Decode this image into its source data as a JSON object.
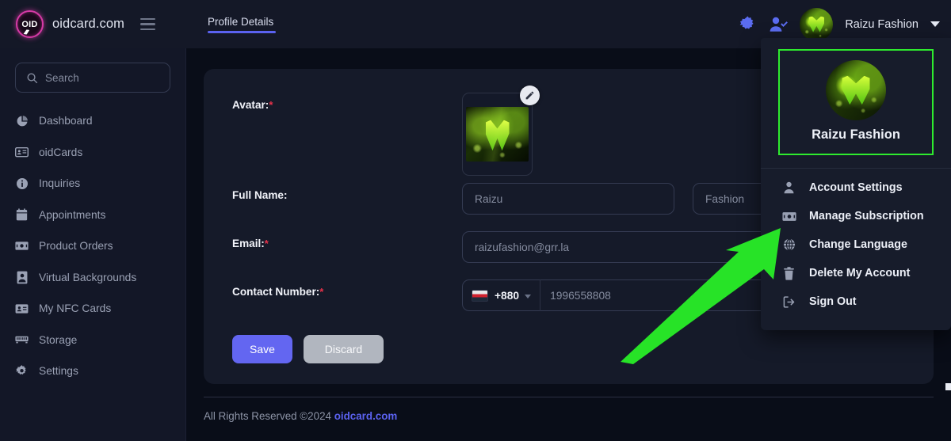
{
  "brand": {
    "name": "oidcard.com",
    "logo_text": "OID",
    "menu_icon": "hamburger-icon"
  },
  "header": {
    "tab": {
      "label": "Profile Details"
    },
    "settings_icon": "gear-icon",
    "user_check_icon": "user-check-icon",
    "user_name": "Raizu Fashion",
    "chevron_icon": "chevron-down-icon"
  },
  "sidebar": {
    "search": {
      "placeholder": "Search",
      "icon": "search-icon"
    },
    "items": [
      {
        "label": "Dashboard",
        "icon": "pie-chart-icon"
      },
      {
        "label": "oidCards",
        "icon": "id-card-icon"
      },
      {
        "label": "Inquiries",
        "icon": "info-icon"
      },
      {
        "label": "Appointments",
        "icon": "calendar-icon"
      },
      {
        "label": "Product Orders",
        "icon": "money-icon"
      },
      {
        "label": "Virtual Backgrounds",
        "icon": "portrait-icon"
      },
      {
        "label": "My NFC Cards",
        "icon": "contact-card-icon"
      },
      {
        "label": "Storage",
        "icon": "storage-icon"
      },
      {
        "label": "Settings",
        "icon": "gear-icon"
      }
    ]
  },
  "form": {
    "avatar": {
      "label": "Avatar:",
      "required": "*",
      "edit_icon": "pencil-icon"
    },
    "full_name": {
      "label": "Full Name:",
      "first_placeholder": "Raizu",
      "last_placeholder": "Fashion"
    },
    "email": {
      "label": "Email:",
      "required": "*",
      "placeholder": "raizufashion@grr.la"
    },
    "contact": {
      "label": "Contact Number:",
      "required": "*",
      "country_code": "+880",
      "flag_icon": "bangladesh-flag-icon",
      "placeholder": "1996558808"
    },
    "save_label": "Save",
    "discard_label": "Discard"
  },
  "footer": {
    "text": "All Rights Reserved ©2024",
    "link": "oidcard.com"
  },
  "dropdown": {
    "profile_name": "Raizu Fashion",
    "highlight_color": "#2eeb2e",
    "items": [
      {
        "label": "Account Settings",
        "icon": "person-icon"
      },
      {
        "label": "Manage Subscription",
        "icon": "money-icon"
      },
      {
        "label": "Change Language",
        "icon": "globe-icon"
      },
      {
        "label": "Delete My Account",
        "icon": "trash-icon"
      },
      {
        "label": "Sign Out",
        "icon": "sign-out-icon"
      }
    ]
  },
  "annotation": {
    "arrow_color": "#27e327",
    "points_to": "Manage Subscription"
  },
  "colors": {
    "accent": "#5b62f0",
    "save": "#6366f1",
    "required": "#e8324a",
    "brand_ring": "#d63aa6"
  }
}
